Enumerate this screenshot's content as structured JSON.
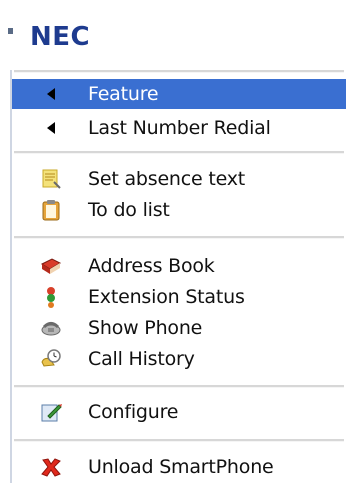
{
  "brand": {
    "logo_text": "NEC"
  },
  "menu": {
    "feature": {
      "label": "Feature",
      "icon": "triangle-left-icon"
    },
    "last_number_redial": {
      "label": "Last Number Redial",
      "icon": "triangle-left-icon"
    },
    "set_absence_text": {
      "label": "Set absence text",
      "icon": "note-icon"
    },
    "to_do_list": {
      "label": "To do list",
      "icon": "clipboard-icon"
    },
    "address_book": {
      "label": "Address Book",
      "icon": "address-book-icon"
    },
    "extension_status": {
      "label": "Extension Status",
      "icon": "status-lights-icon"
    },
    "show_phone": {
      "label": "Show Phone",
      "icon": "phone-icon"
    },
    "call_history": {
      "label": "Call History",
      "icon": "clock-icon"
    },
    "configure": {
      "label": "Configure",
      "icon": "edit-icon"
    },
    "unload_smartphone": {
      "label": "Unload SmartPhone",
      "icon": "red-x-icon"
    }
  },
  "colors": {
    "selection": "#3a6fd1",
    "logo": "#1e3b8f",
    "separator": "#d7d7d7"
  }
}
